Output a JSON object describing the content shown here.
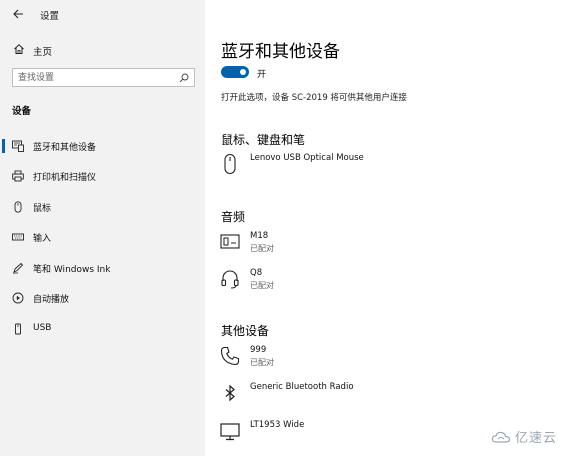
{
  "window": {
    "title": "设置"
  },
  "sidebar": {
    "home_label": "主页",
    "search_placeholder": "查找设置",
    "section_label": "设备",
    "items": [
      {
        "label": "蓝牙和其他设备",
        "icon": "bluetooth-devices-icon",
        "active": true
      },
      {
        "label": "打印机和扫描仪",
        "icon": "printer-icon"
      },
      {
        "label": "鼠标",
        "icon": "mouse-icon"
      },
      {
        "label": "输入",
        "icon": "keyboard-icon"
      },
      {
        "label": "笔和 Windows Ink",
        "icon": "pen-icon"
      },
      {
        "label": "自动播放",
        "icon": "autoplay-icon"
      },
      {
        "label": "USB",
        "icon": "usb-icon"
      }
    ]
  },
  "main": {
    "title": "蓝牙和其他设备",
    "toggle": {
      "state": "on",
      "label": "开"
    },
    "discoverable_text": "打开此选项，设备 SC-2019 将可供其他用户连接",
    "groups": [
      {
        "title": "鼠标、键盘和笔",
        "devices": [
          {
            "name": "Lenovo USB Optical Mouse",
            "status": "",
            "icon": "mouse-icon"
          }
        ]
      },
      {
        "title": "音频",
        "devices": [
          {
            "name": "M18",
            "status": "已配对",
            "icon": "audio-device-icon"
          },
          {
            "name": "Q8",
            "status": "已配对",
            "icon": "headset-icon"
          }
        ]
      },
      {
        "title": "其他设备",
        "devices": [
          {
            "name": "999",
            "status": "已配对",
            "icon": "phone-icon"
          },
          {
            "name": "Generic Bluetooth Radio",
            "status": "",
            "icon": "bluetooth-icon"
          },
          {
            "name": "LT1953 Wide",
            "status": "",
            "icon": "monitor-icon"
          }
        ]
      }
    ]
  },
  "watermark": {
    "text": "亿速云"
  },
  "colors": {
    "accent": "#0063b1",
    "sidebar_bg": "#f2f2f2"
  }
}
